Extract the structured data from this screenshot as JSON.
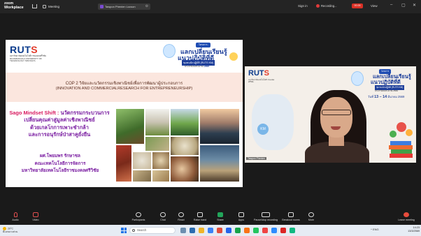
{
  "titlebar": {
    "brand_line1": "zoom",
    "brand_line2": "Workplace",
    "meeting_label": "Meeting",
    "tab_label": "Tawpon Phenien Locson",
    "sign_in": "Sign in",
    "recording": "Recording...",
    "red_badge": "00:26",
    "view": "View",
    "window_buttons": [
      "–",
      "▢",
      "✕"
    ]
  },
  "slide": {
    "logo": "RUT",
    "logo_s": "S",
    "logo_sub": "มหาวิทยาลัยเทคโนโลยีราชมงคลศรีวิชัย RAJAMANGALA UNIVERSITY OF TECHNOLOGY SRIVIJAYA",
    "banner_tag": "โครงการ",
    "banner_title1": "แลกเปลี่ยนเรียนรู้",
    "banner_title2": "แนวปฏิบัติที่ดี",
    "banner_sub": "ชุมชนนักปฏิบัติ (RUTS KM)",
    "banner_year_label": "ประจำปีงบประมาณ",
    "banner_year": "2569",
    "cop_line1": "COP 2 วิจัยและนวัตกรรมเชิงพาณิชย์เพื่อการพัฒนาผู้ประกอบการ",
    "cop_line2": "(INNOVATION AND COMMERCIALRESEARCH FOR ENTREPRENEURSHIP)",
    "sago_head": "Sago Mindset Shift :",
    "sago_rest": " นวัตกรรมกระบวนการ",
    "sago_line2": "เปลี่ยนคุณค่าสู่มูลค่าเชิงพาณิชย์",
    "sago_line3": "ด้วยเกลโกการเพาะชำกล้า",
    "sago_line4": "และการอนุรักษ์ป่าสาคูยั่งยืน",
    "author1": "ผศ.โพยมพร รักษาชล",
    "author2": "คณะเทคโนโลยีการจัดการ",
    "author3": "มหาวิทยาลัยเทคโนโลยีราชมงคลศรีวิชัย"
  },
  "video": {
    "logo": "RUT",
    "logo_s": "S",
    "logo_sub": "มหาวิทยาลัยเทคโนโลยีราชมงคลศรีวิชัย",
    "tag": "โครงการ",
    "title1": "แลกเปลี่ยนเรียนรู้",
    "title2": "แนวปฏิบัติที่ดี",
    "sub": "ชุมชนนักปฏิบัติ (RUTS KM)",
    "year": "ประจำปีงบประมาณ 2569",
    "date_prefix": "วันที่",
    "date_days": "13 – 14",
    "date_rest": "มีนาคม 2569",
    "km": "KM",
    "participant": "Tawpon Phenien"
  },
  "toolbar": {
    "audio": "Audio",
    "video": "Video",
    "participants": "Participants",
    "chat": "Chat",
    "react": "React",
    "raise_hand": "Raise hand",
    "share": "Share",
    "apps": "Apps",
    "pause_recording": "Pause/stop recording",
    "breakout_rooms": "Breakout rooms",
    "more": "More",
    "leave": "Leave meeting"
  },
  "taskbar": {
    "temp": "29°C",
    "weather": "มีเมฆบางส่วน",
    "search": "Search",
    "tray": "^  ENG",
    "time": "14:23",
    "date": "13/3/2569"
  },
  "colors": {
    "purple_text": "#7b1fa2",
    "pink_band": "#fbe6de",
    "brand_blue": "#1d3e9a",
    "record_red": "#d93025"
  }
}
